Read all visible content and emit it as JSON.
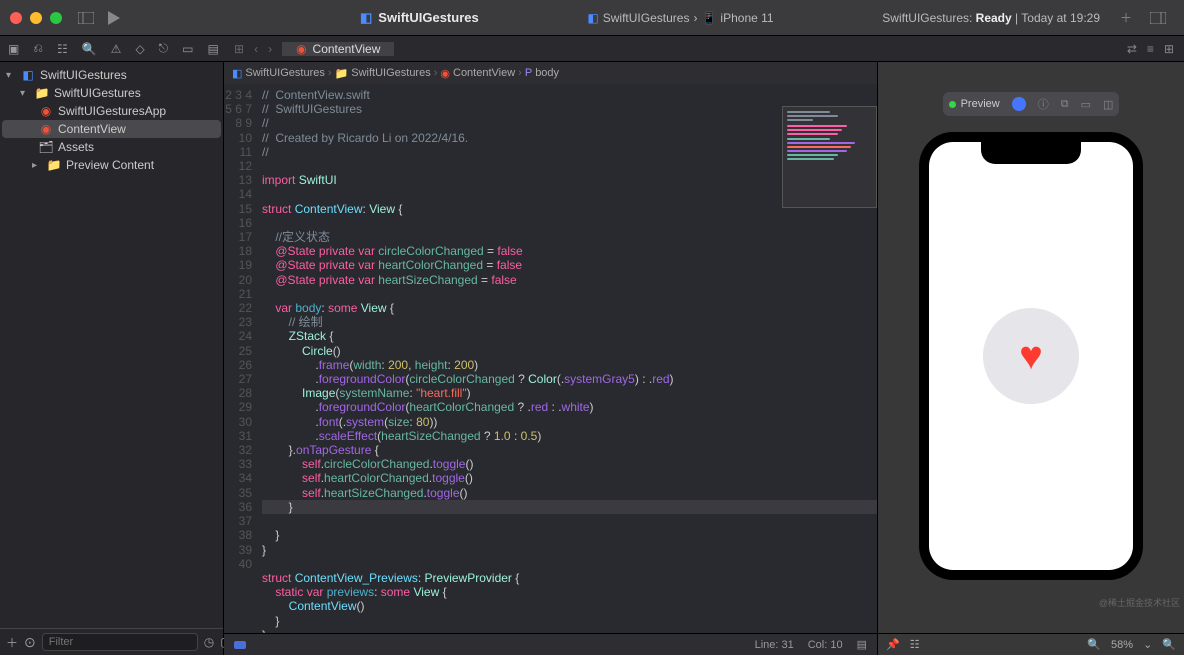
{
  "title": {
    "appName": "SwiftUIGestures"
  },
  "titleCenter": {
    "project": "SwiftUIGestures",
    "device": "iPhone 11"
  },
  "status": {
    "prefix": "SwiftUIGestures:",
    "state": "Ready",
    "rest": " | Today at 19:29"
  },
  "toolbar": {
    "tabName": "ContentView"
  },
  "breadcrumb": {
    "a": "SwiftUIGestures",
    "b": "SwiftUIGestures",
    "c": "ContentView",
    "d": "body"
  },
  "tree": {
    "root": "SwiftUIGestures",
    "folder1": "SwiftUIGestures",
    "file1": "SwiftUIGesturesApp",
    "file2": "ContentView",
    "file3": "Assets",
    "folder2": "Preview Content"
  },
  "filter": {
    "placeholder": "Filter"
  },
  "code": {
    "lines": [
      "//  ContentView.swift",
      "//  SwiftUIGestures",
      "//",
      "//  Created by Ricardo Li on 2022/4/16.",
      "//",
      "",
      "import SwiftUI",
      "",
      "struct ContentView: View {",
      "",
      "    //定义状态",
      "    @State private var circleColorChanged = false",
      "    @State private var heartColorChanged = false",
      "    @State private var heartSizeChanged = false",
      "",
      "    var body: some View {",
      "        // 绘制",
      "        ZStack {",
      "            Circle()",
      "                .frame(width: 200, height: 200)",
      "                .foregroundColor(circleColorChanged ? Color(.systemGray5) : .red)",
      "            Image(systemName: \"heart.fill\")",
      "                .foregroundColor(heartColorChanged ? .red : .white)",
      "                .font(.system(size: 80))",
      "                .scaleEffect(heartSizeChanged ? 1.0 : 0.5)",
      "        }.onTapGesture {",
      "            self.circleColorChanged.toggle()",
      "            self.heartColorChanged.toggle()",
      "            self.heartSizeChanged.toggle()",
      "        }",
      "    }",
      "}",
      "",
      "struct ContentView_Previews: PreviewProvider {",
      "    static var previews: some View {",
      "        ContentView()",
      "    }",
      "}",
      ""
    ],
    "startLine": 2
  },
  "editorStatus": {
    "line": "Line: 31",
    "col": "Col: 10"
  },
  "preview": {
    "label": "Preview",
    "zoom": "58%"
  },
  "watermark": "@稀土掘金技术社区"
}
